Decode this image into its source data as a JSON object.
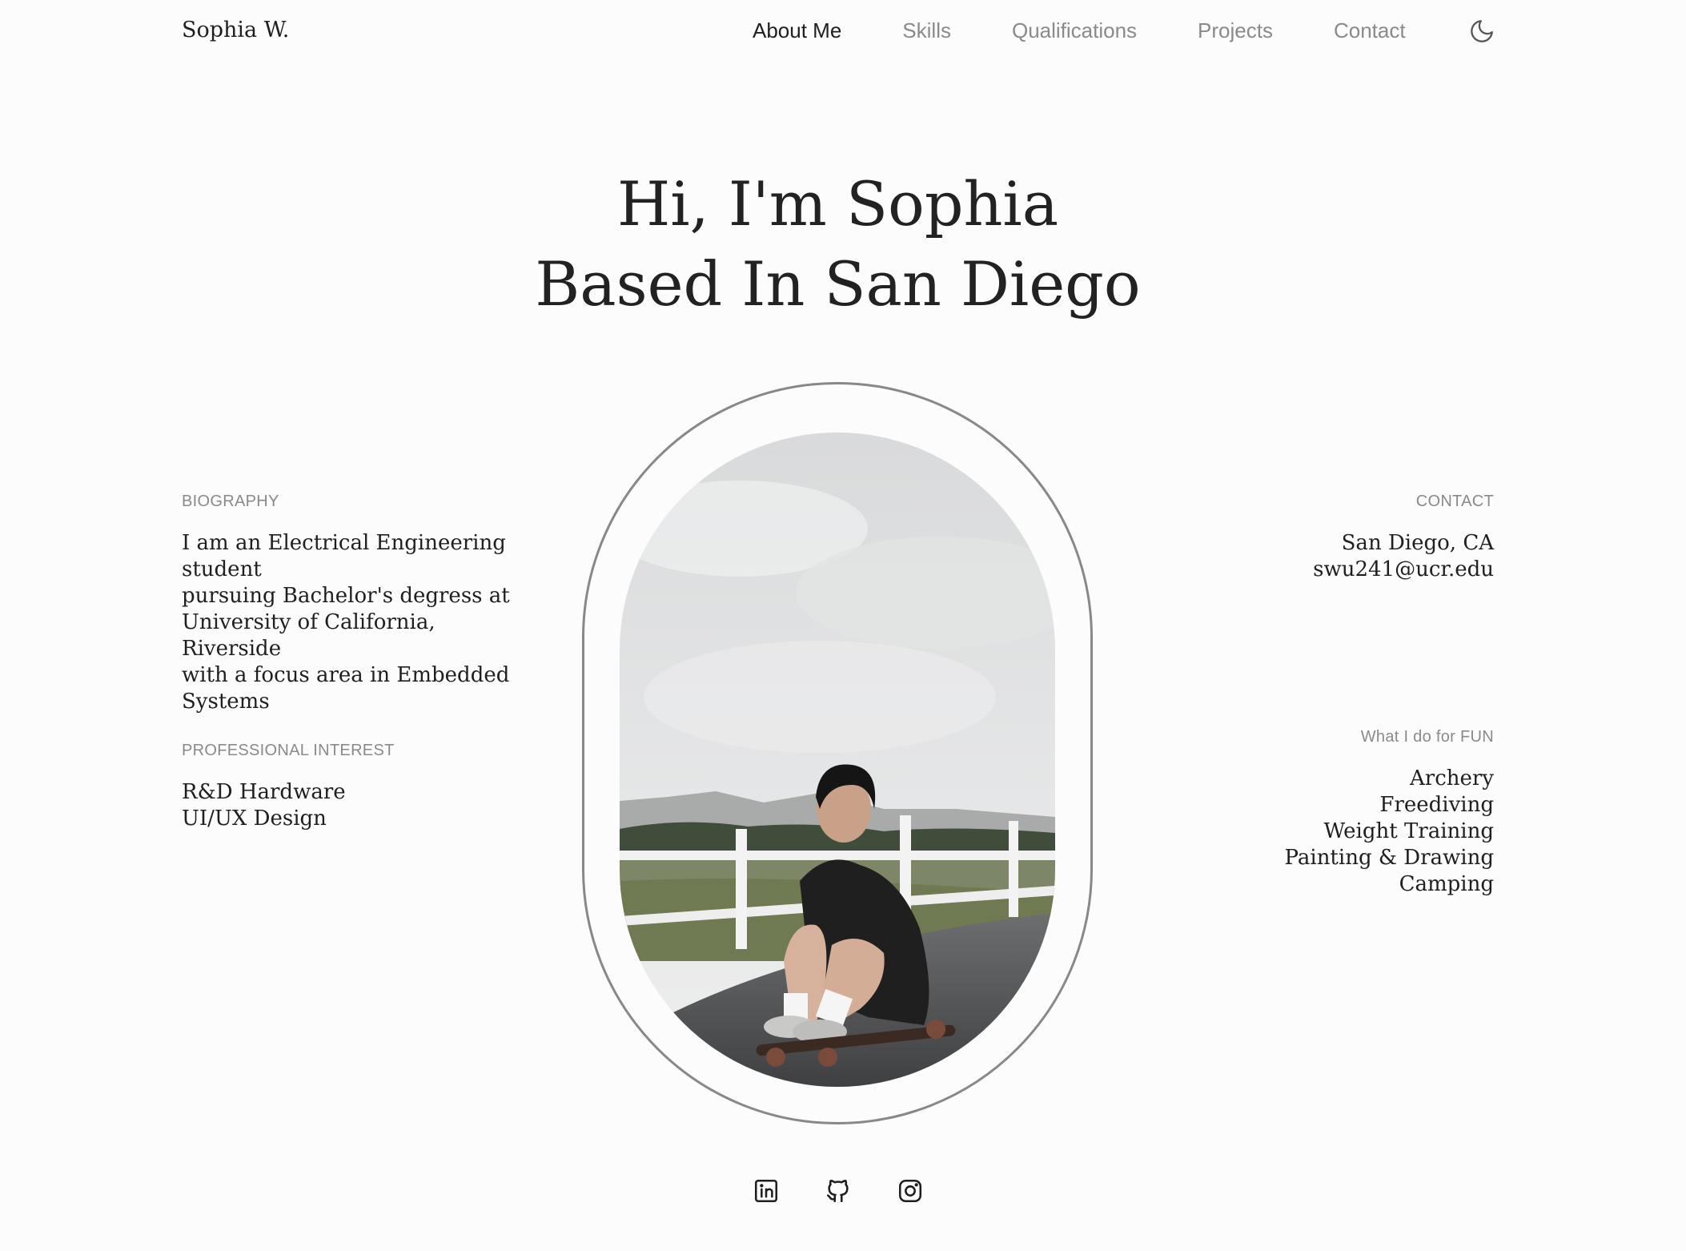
{
  "brand": "Sophia W.",
  "nav": {
    "about": "About Me",
    "skills": "Skills",
    "qualifications": "Qualifications",
    "projects": "Projects",
    "contact": "Contact"
  },
  "hero": {
    "line1": "Hi, I'm Sophia",
    "line2": "Based In San Diego"
  },
  "biography": {
    "label": "BIOGRAPHY",
    "lines": [
      "I am an Electrical Engineering",
      "student",
      "pursuing Bachelor's degress at",
      "University of California,",
      "Riverside",
      "with a focus area in Embedded",
      "Systems"
    ]
  },
  "professional_interest": {
    "label": "PROFESSIONAL INTEREST",
    "items": [
      "R&D Hardware",
      "UI/UX Design"
    ]
  },
  "contact": {
    "label": "CONTACT",
    "location": "San Diego, CA",
    "email": "swu241@ucr.edu"
  },
  "fun": {
    "label": "What I do for FUN",
    "items": [
      "Archery",
      "Freediving",
      "Weight Training",
      "Painting & Drawing",
      "Camping"
    ]
  },
  "icons": {
    "theme": "moon-icon",
    "linkedin": "linkedin-icon",
    "github": "github-icon",
    "instagram": "instagram-icon"
  },
  "colors": {
    "background": "#fcfcfc",
    "text": "#1f1f1f",
    "muted": "#8a8a8a",
    "frame": "#888888"
  }
}
